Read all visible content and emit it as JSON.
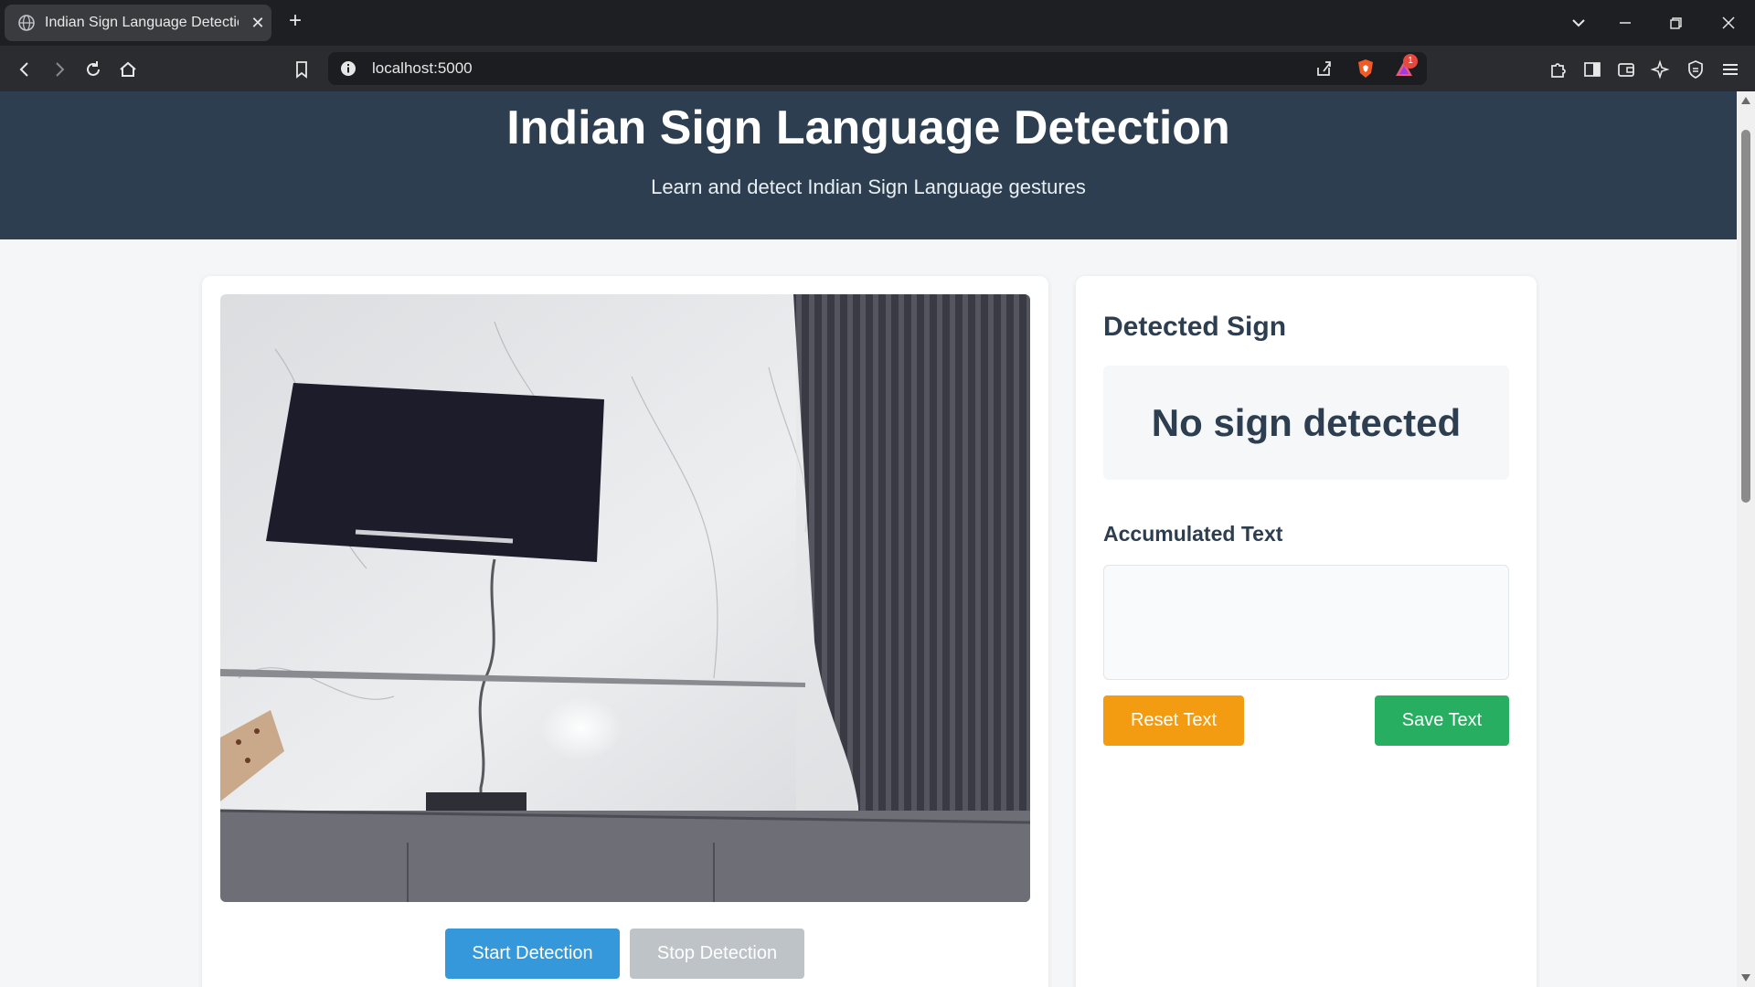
{
  "browser": {
    "tab_title": "Indian Sign Language Detection",
    "new_tab_label": "+",
    "close_label": "✕",
    "url": "localhost:5000",
    "notification_count": "1"
  },
  "page": {
    "title": "Indian Sign Language Detection",
    "subtitle": "Learn and detect Indian Sign Language gestures"
  },
  "video_panel": {
    "start_label": "Start Detection",
    "stop_label": "Stop Detection"
  },
  "side_panel": {
    "detected_heading": "Detected Sign",
    "detected_value": "No sign detected",
    "accumulated_heading": "Accumulated Text",
    "accumulated_value": "",
    "reset_label": "Reset Text",
    "save_label": "Save Text"
  },
  "colors": {
    "header_bg": "#2c3e50",
    "start_button": "#3498db",
    "stop_button": "#bdc3c7",
    "reset_button": "#f39c12",
    "save_button": "#27ae60"
  }
}
